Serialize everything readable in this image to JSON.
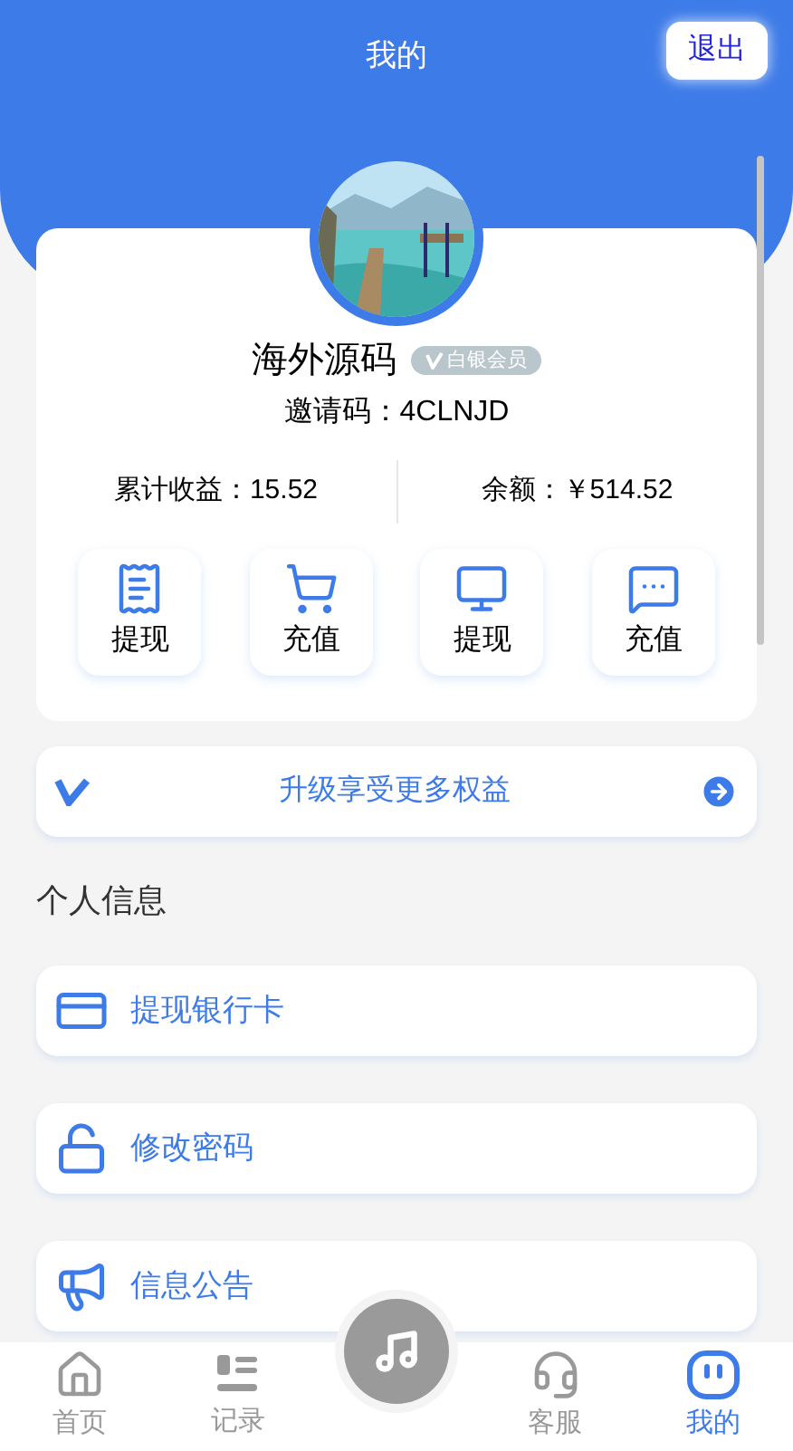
{
  "header": {
    "title": "我的",
    "logout": "退出"
  },
  "profile": {
    "name": "海外源码",
    "badge": "白银会员",
    "invite": "邀请码：4CLNJD"
  },
  "stats": [
    "累计收益：15.52",
    "余额：￥514.52"
  ],
  "actions": [
    {
      "label": "提现",
      "kind": "receipt"
    },
    {
      "label": "充值",
      "kind": "cart"
    },
    {
      "label": "提现",
      "kind": "monitor"
    },
    {
      "label": "充值",
      "kind": "chat"
    }
  ],
  "upgrade": "升级享受更多权益",
  "section_title": "个人信息",
  "menu": [
    {
      "label": "提现银行卡",
      "kind": "card"
    },
    {
      "label": "修改密码",
      "kind": "lock"
    },
    {
      "label": "信息公告",
      "kind": "megaphone"
    }
  ],
  "nav": [
    {
      "label": "首页",
      "kind": "home",
      "selected": false
    },
    {
      "label": "记录",
      "kind": "list",
      "selected": false
    },
    {
      "kind": "center",
      "selected": false
    },
    {
      "label": "客服",
      "kind": "service",
      "selected": false
    },
    {
      "label": "我的",
      "kind": "me",
      "selected": true
    }
  ]
}
